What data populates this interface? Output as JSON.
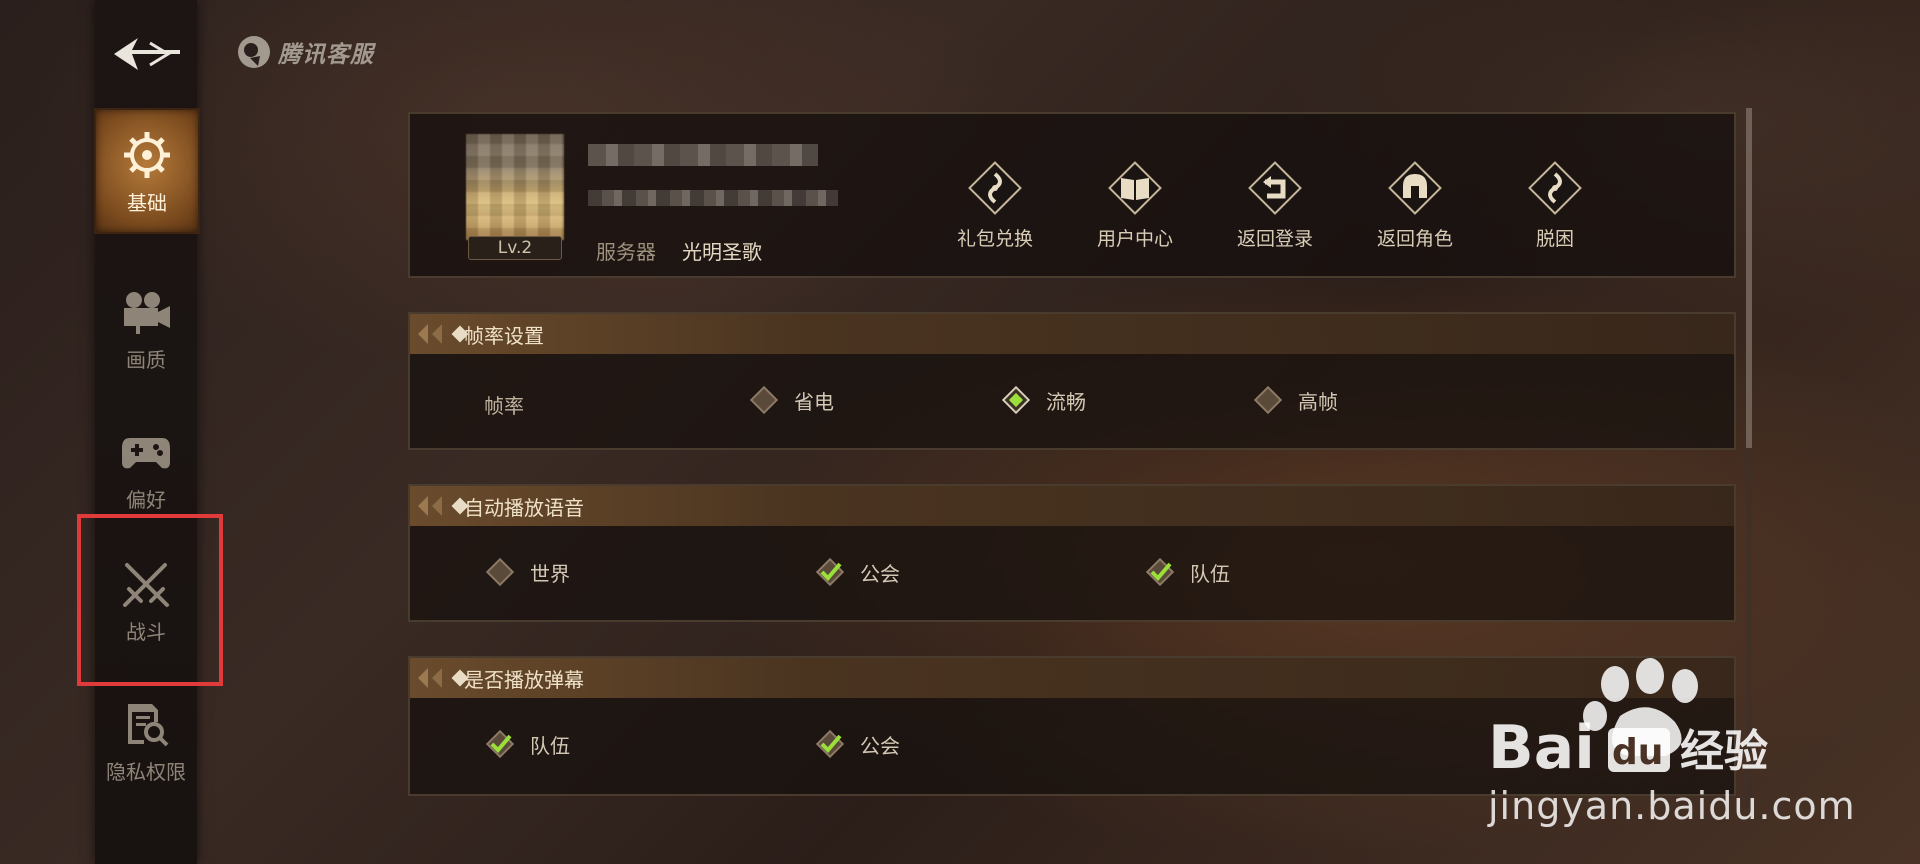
{
  "app": {
    "logo_text": "腾讯客服"
  },
  "sidebar": {
    "items": [
      {
        "label": "基础",
        "icon": "gear-icon",
        "active": true
      },
      {
        "label": "画质",
        "icon": "camera-icon",
        "active": false
      },
      {
        "label": "偏好",
        "icon": "gamepad-icon",
        "active": false
      },
      {
        "label": "战斗",
        "icon": "crossed-swords-icon",
        "active": false
      },
      {
        "label": "隐私权限",
        "icon": "privacy-search-icon",
        "active": false
      }
    ]
  },
  "profile": {
    "level": "Lv.2",
    "server_label": "服务器",
    "server_name": "光明圣歌",
    "actions": [
      {
        "label": "礼包兑换",
        "icon": "gift-icon"
      },
      {
        "label": "用户中心",
        "icon": "book-icon"
      },
      {
        "label": "返回登录",
        "icon": "return-arrow-icon"
      },
      {
        "label": "返回角色",
        "icon": "helmet-icon"
      },
      {
        "label": "脱困",
        "icon": "escape-icon"
      }
    ]
  },
  "sections": {
    "framerate": {
      "title": "帧率设置",
      "row_label": "帧率",
      "options": [
        {
          "label": "省电",
          "selected": false
        },
        {
          "label": "流畅",
          "selected": true
        },
        {
          "label": "高帧",
          "selected": false
        }
      ]
    },
    "voice": {
      "title": "自动播放语音",
      "options": [
        {
          "label": "世界",
          "checked": false
        },
        {
          "label": "公会",
          "checked": true
        },
        {
          "label": "队伍",
          "checked": true
        }
      ]
    },
    "danmaku": {
      "title": "是否播放弹幕",
      "options": [
        {
          "label": "队伍",
          "checked": true
        },
        {
          "label": "公会",
          "checked": true
        }
      ]
    }
  },
  "watermark": {
    "brand": "Bai du 经验",
    "url": "jingyan.baidu.com"
  },
  "colors": {
    "accent_green": "#9be03a",
    "active_tab": "#a86c32",
    "highlight": "#e13a3a"
  }
}
